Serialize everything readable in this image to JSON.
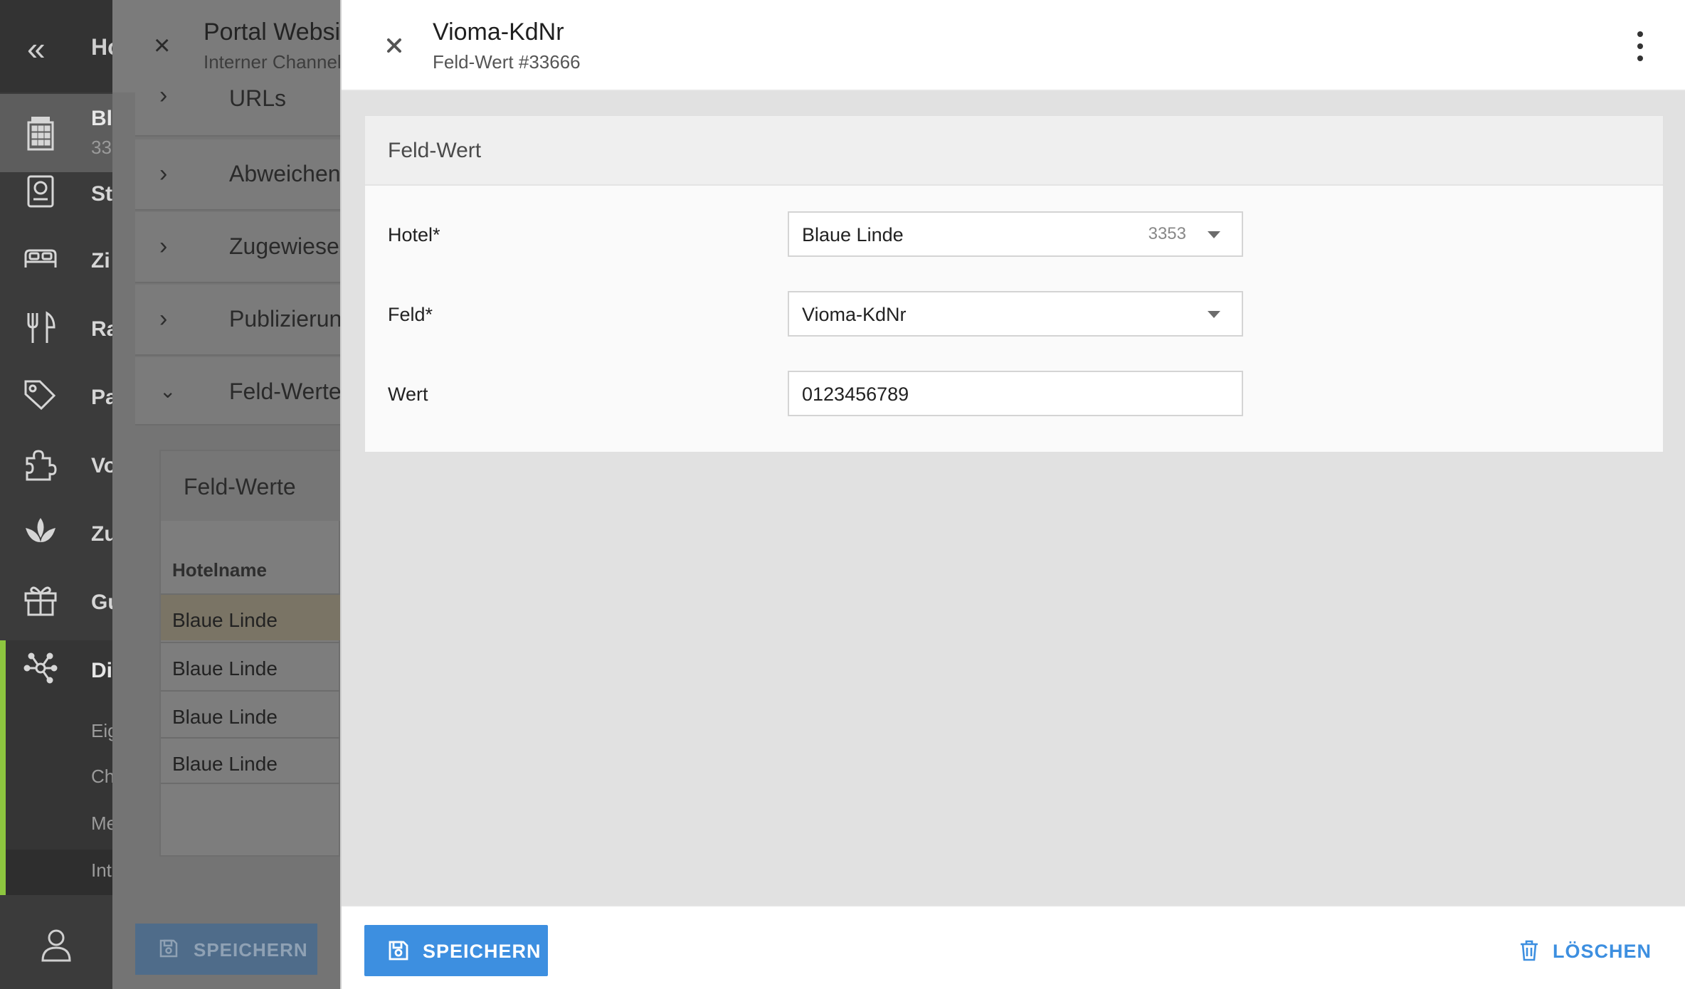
{
  "sidebar": {
    "collapse_glyph": "«",
    "header_label": "Ho",
    "hotel": {
      "name": "Bl",
      "number": "33"
    },
    "items": [
      {
        "label": "St",
        "icon": "passport-icon"
      },
      {
        "label": "Zi",
        "icon": "bed-icon"
      },
      {
        "label": "Ra",
        "icon": "fork-knife-icon"
      },
      {
        "label": "Pa",
        "icon": "tags-icon"
      },
      {
        "label": "Vo",
        "icon": "puzzle-icon"
      },
      {
        "label": "Zu",
        "icon": "lotus-icon"
      },
      {
        "label": "Gu",
        "icon": "gift-icon"
      },
      {
        "label": "Di",
        "icon": "network-icon"
      }
    ],
    "subitems": [
      "Eig",
      "Ch",
      "Me",
      "Int"
    ],
    "accent_color": "#8dc63f"
  },
  "background_panel": {
    "title": "Portal Website",
    "subtitle": "Interner Channel",
    "sections": [
      "URLs",
      "Abweichende",
      "Zugewiesene",
      "Publizierungs",
      "Feld-Werte"
    ],
    "card_title": "Feld-Werte",
    "column_header": "Hotelname",
    "rows": [
      "Blaue Linde",
      "Blaue Linde",
      "Blaue Linde",
      "Blaue Linde"
    ],
    "save_label": "SPEICHERN"
  },
  "panel": {
    "title": "Vioma-KdNr",
    "subtitle": "Feld-Wert #33666",
    "card_title": "Feld-Wert",
    "fields": {
      "hotel": {
        "label": "Hotel*",
        "value": "Blaue Linde",
        "badge": "3353"
      },
      "feld": {
        "label": "Feld*",
        "value": "Vioma-KdNr"
      },
      "wert": {
        "label": "Wert",
        "value": "0123456789"
      }
    },
    "save_label": "SPEICHERN",
    "delete_label": "LÖSCHEN",
    "primary_color": "#3d8fe0"
  }
}
